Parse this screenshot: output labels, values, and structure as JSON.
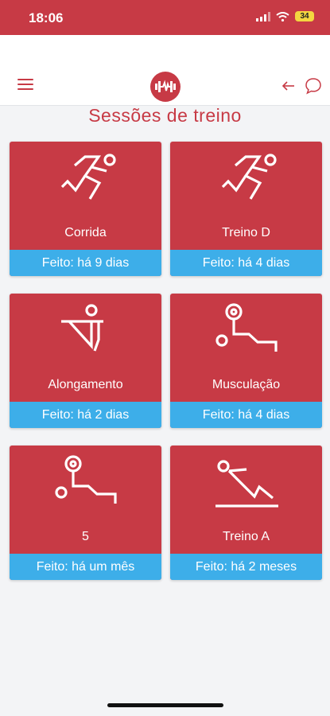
{
  "status": {
    "time": "18:06",
    "battery": "34"
  },
  "header": {
    "menu_icon": "hamburger-icon",
    "logo_icon": "dumbbell-logo-icon",
    "back_icon": "arrow-left-icon",
    "chat_icon": "chat-bubble-icon"
  },
  "page": {
    "title": "Sessões de treino"
  },
  "colors": {
    "primary": "#c73a45",
    "accent": "#3daee9",
    "background": "#f3f4f6"
  },
  "sessions": [
    {
      "name": "Corrida",
      "status": "Feito: há 9 dias",
      "icon": "running-icon"
    },
    {
      "name": "Treino D",
      "status": "Feito: há 4 dias",
      "icon": "running-icon"
    },
    {
      "name": "Alongamento",
      "status": "Feito: há 2 dias",
      "icon": "stretching-icon"
    },
    {
      "name": "Musculação",
      "status": "Feito: há 4 dias",
      "icon": "weightlifting-icon"
    },
    {
      "name": "5",
      "status": "Feito: há um mês",
      "icon": "weightlifting-icon"
    },
    {
      "name": "Treino A",
      "status": "Feito: há 2 meses",
      "icon": "situp-icon"
    }
  ]
}
